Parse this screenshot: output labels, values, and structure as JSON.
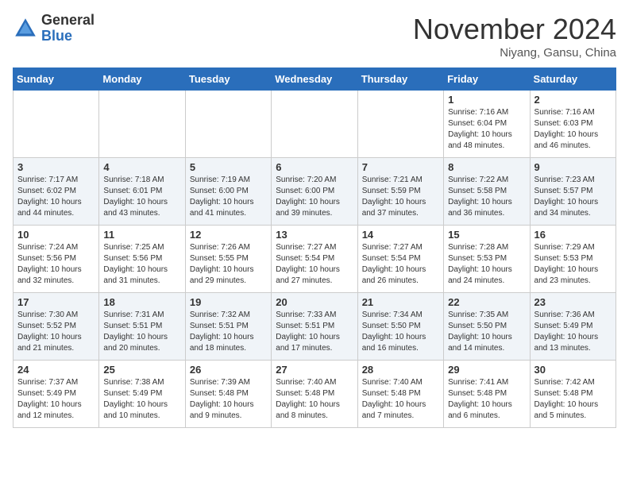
{
  "header": {
    "logo_general": "General",
    "logo_blue": "Blue",
    "month_title": "November 2024",
    "location": "Niyang, Gansu, China"
  },
  "weekdays": [
    "Sunday",
    "Monday",
    "Tuesday",
    "Wednesday",
    "Thursday",
    "Friday",
    "Saturday"
  ],
  "weeks": [
    [
      {
        "day": "",
        "info": ""
      },
      {
        "day": "",
        "info": ""
      },
      {
        "day": "",
        "info": ""
      },
      {
        "day": "",
        "info": ""
      },
      {
        "day": "",
        "info": ""
      },
      {
        "day": "1",
        "info": "Sunrise: 7:16 AM\nSunset: 6:04 PM\nDaylight: 10 hours and 48 minutes."
      },
      {
        "day": "2",
        "info": "Sunrise: 7:16 AM\nSunset: 6:03 PM\nDaylight: 10 hours and 46 minutes."
      }
    ],
    [
      {
        "day": "3",
        "info": "Sunrise: 7:17 AM\nSunset: 6:02 PM\nDaylight: 10 hours and 44 minutes."
      },
      {
        "day": "4",
        "info": "Sunrise: 7:18 AM\nSunset: 6:01 PM\nDaylight: 10 hours and 43 minutes."
      },
      {
        "day": "5",
        "info": "Sunrise: 7:19 AM\nSunset: 6:00 PM\nDaylight: 10 hours and 41 minutes."
      },
      {
        "day": "6",
        "info": "Sunrise: 7:20 AM\nSunset: 6:00 PM\nDaylight: 10 hours and 39 minutes."
      },
      {
        "day": "7",
        "info": "Sunrise: 7:21 AM\nSunset: 5:59 PM\nDaylight: 10 hours and 37 minutes."
      },
      {
        "day": "8",
        "info": "Sunrise: 7:22 AM\nSunset: 5:58 PM\nDaylight: 10 hours and 36 minutes."
      },
      {
        "day": "9",
        "info": "Sunrise: 7:23 AM\nSunset: 5:57 PM\nDaylight: 10 hours and 34 minutes."
      }
    ],
    [
      {
        "day": "10",
        "info": "Sunrise: 7:24 AM\nSunset: 5:56 PM\nDaylight: 10 hours and 32 minutes."
      },
      {
        "day": "11",
        "info": "Sunrise: 7:25 AM\nSunset: 5:56 PM\nDaylight: 10 hours and 31 minutes."
      },
      {
        "day": "12",
        "info": "Sunrise: 7:26 AM\nSunset: 5:55 PM\nDaylight: 10 hours and 29 minutes."
      },
      {
        "day": "13",
        "info": "Sunrise: 7:27 AM\nSunset: 5:54 PM\nDaylight: 10 hours and 27 minutes."
      },
      {
        "day": "14",
        "info": "Sunrise: 7:27 AM\nSunset: 5:54 PM\nDaylight: 10 hours and 26 minutes."
      },
      {
        "day": "15",
        "info": "Sunrise: 7:28 AM\nSunset: 5:53 PM\nDaylight: 10 hours and 24 minutes."
      },
      {
        "day": "16",
        "info": "Sunrise: 7:29 AM\nSunset: 5:53 PM\nDaylight: 10 hours and 23 minutes."
      }
    ],
    [
      {
        "day": "17",
        "info": "Sunrise: 7:30 AM\nSunset: 5:52 PM\nDaylight: 10 hours and 21 minutes."
      },
      {
        "day": "18",
        "info": "Sunrise: 7:31 AM\nSunset: 5:51 PM\nDaylight: 10 hours and 20 minutes."
      },
      {
        "day": "19",
        "info": "Sunrise: 7:32 AM\nSunset: 5:51 PM\nDaylight: 10 hours and 18 minutes."
      },
      {
        "day": "20",
        "info": "Sunrise: 7:33 AM\nSunset: 5:51 PM\nDaylight: 10 hours and 17 minutes."
      },
      {
        "day": "21",
        "info": "Sunrise: 7:34 AM\nSunset: 5:50 PM\nDaylight: 10 hours and 16 minutes."
      },
      {
        "day": "22",
        "info": "Sunrise: 7:35 AM\nSunset: 5:50 PM\nDaylight: 10 hours and 14 minutes."
      },
      {
        "day": "23",
        "info": "Sunrise: 7:36 AM\nSunset: 5:49 PM\nDaylight: 10 hours and 13 minutes."
      }
    ],
    [
      {
        "day": "24",
        "info": "Sunrise: 7:37 AM\nSunset: 5:49 PM\nDaylight: 10 hours and 12 minutes."
      },
      {
        "day": "25",
        "info": "Sunrise: 7:38 AM\nSunset: 5:49 PM\nDaylight: 10 hours and 10 minutes."
      },
      {
        "day": "26",
        "info": "Sunrise: 7:39 AM\nSunset: 5:48 PM\nDaylight: 10 hours and 9 minutes."
      },
      {
        "day": "27",
        "info": "Sunrise: 7:40 AM\nSunset: 5:48 PM\nDaylight: 10 hours and 8 minutes."
      },
      {
        "day": "28",
        "info": "Sunrise: 7:40 AM\nSunset: 5:48 PM\nDaylight: 10 hours and 7 minutes."
      },
      {
        "day": "29",
        "info": "Sunrise: 7:41 AM\nSunset: 5:48 PM\nDaylight: 10 hours and 6 minutes."
      },
      {
        "day": "30",
        "info": "Sunrise: 7:42 AM\nSunset: 5:48 PM\nDaylight: 10 hours and 5 minutes."
      }
    ]
  ]
}
